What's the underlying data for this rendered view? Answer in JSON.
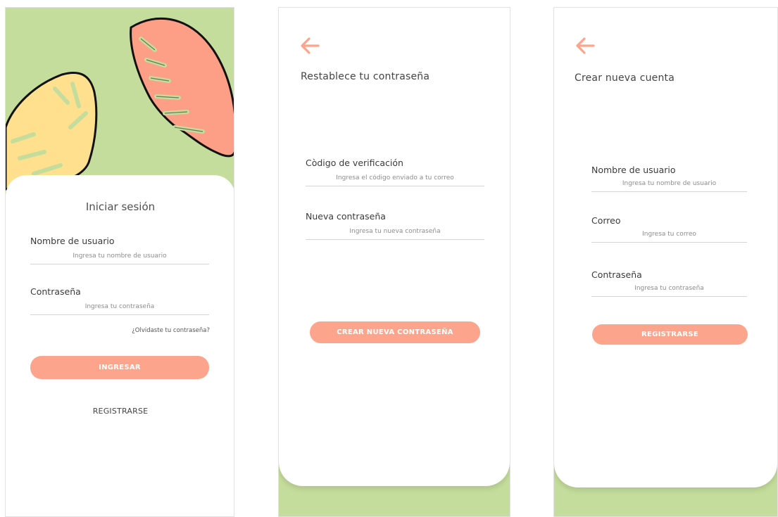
{
  "colors": {
    "accent": "#fca48c",
    "green_bg": "#c5dd9c",
    "leaf_yellow": "#ffe08e",
    "leaf_coral": "#fd9e86"
  },
  "login": {
    "title": "Iniciar sesión",
    "username_label": "Nombre de usuario",
    "username_placeholder": "Ingresa tu nombre de usuario",
    "password_label": "Contraseña",
    "password_placeholder": "Ingresa tu contraseña",
    "forgot_link": "¿Olvidaste tu contraseña?",
    "submit_button": "INGRESAR",
    "register_link": "REGISTRARSE"
  },
  "reset": {
    "back_icon": "arrow-left-icon",
    "title": "Restablece tu contraseña",
    "code_label": "Còdigo de verificación",
    "code_placeholder": "Ingresa el código enviado a tu correo",
    "new_password_label": "Nueva contraseña",
    "new_password_placeholder": "Ingresa tu nueva contraseña",
    "submit_button": "CREAR NUEVA CONTRASEÑA"
  },
  "register": {
    "back_icon": "arrow-left-icon",
    "title": "Crear nueva cuenta",
    "username_label": "Nombre de usuario",
    "username_placeholder": "Ingresa tu nombre de usuario",
    "email_label": "Correo",
    "email_placeholder": "Ingresa tu correo",
    "password_label": "Contraseña",
    "password_placeholder": "Ingresa tu contraseña",
    "submit_button": "REGISTRARSE"
  }
}
